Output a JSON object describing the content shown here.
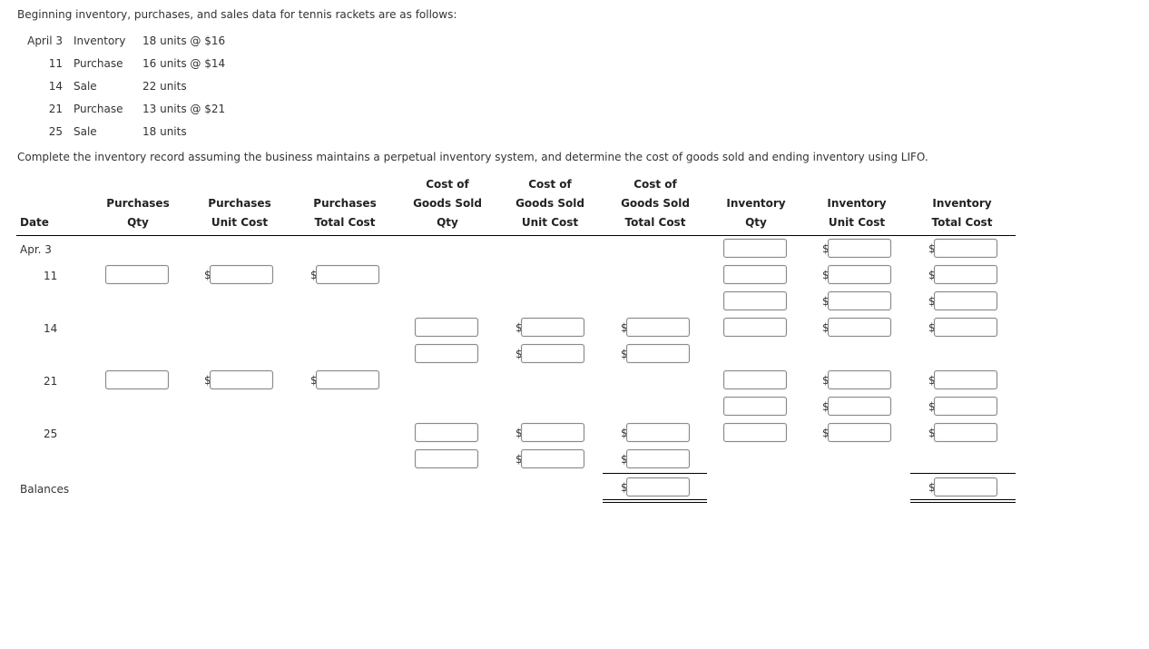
{
  "intro": "Beginning inventory, purchases, and sales data for tennis rackets are as follows:",
  "given_data": [
    {
      "date": "April 3",
      "type": "Inventory",
      "desc": "18 units @ $16"
    },
    {
      "date": "11",
      "type": "Purchase",
      "desc": "16 units @ $14"
    },
    {
      "date": "14",
      "type": "Sale",
      "desc": "22 units"
    },
    {
      "date": "21",
      "type": "Purchase",
      "desc": "13 units @ $21"
    },
    {
      "date": "25",
      "type": "Sale",
      "desc": "18 units"
    }
  ],
  "instruction": "Complete the inventory record assuming the business maintains a perpetual inventory system, and determine the cost of goods sold and ending inventory using LIFO.",
  "table": {
    "headers": {
      "date": "Date",
      "purch_qty": [
        "Purchases",
        "Qty"
      ],
      "purch_unit": [
        "Purchases",
        "Unit Cost"
      ],
      "purch_total": [
        "Purchases",
        "Total Cost"
      ],
      "cogs_qty": [
        "Cost of",
        "Goods Sold",
        "Qty"
      ],
      "cogs_unit": [
        "Cost of",
        "Goods Sold",
        "Unit Cost"
      ],
      "cogs_total": [
        "Cost of",
        "Goods Sold",
        "Total Cost"
      ],
      "inv_qty": [
        "Inventory",
        "Qty"
      ],
      "inv_unit": [
        "Inventory",
        "Unit Cost"
      ],
      "inv_total": [
        "Inventory",
        "Total Cost"
      ]
    },
    "dates": [
      "Apr. 3",
      "11",
      "14",
      "21",
      "25"
    ],
    "balances_label": "Balances",
    "currency_symbol": "$",
    "input_values": ""
  }
}
